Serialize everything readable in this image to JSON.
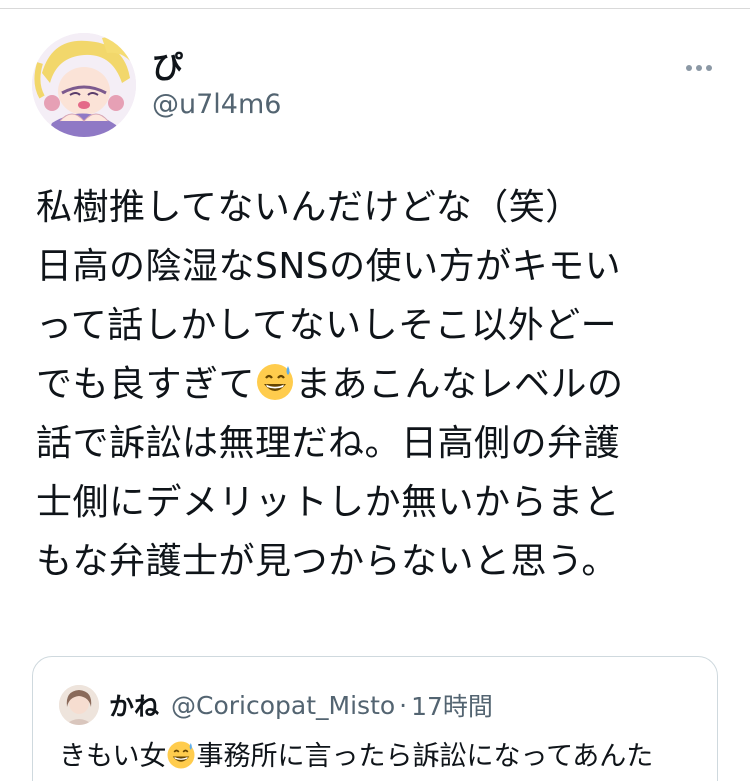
{
  "tweet": {
    "author": {
      "display_name": "ぴ",
      "handle": "@u7l4m6",
      "avatar_icon": "avatar-illustration"
    },
    "more_icon": "more-horizontal-icon",
    "text_lines": [
      "私樹推してないんだけどな（笑）",
      "日高の陰湿なSNSの使い方がキモい",
      "って話しかしてないしそこ以外どー",
      "でも良すぎて",
      "まあこんなレベルの",
      "話で訴訟は無理だね。日高側の弁護",
      "士側にデメリットしか無いからまと",
      "もな弁護士が見つからないと思う。"
    ],
    "emoji": "grinning-sweat-emoji"
  },
  "quote": {
    "display_name": "かね",
    "handle": "@Coricopat_Misto",
    "separator": "·",
    "time": "17時間",
    "text_before_emoji": "きもい女",
    "text_after_emoji": "事務所に言ったら訴訟になってあんた",
    "emoji": "grinning-sweat-emoji"
  },
  "colors": {
    "text_primary": "#0f1419",
    "text_secondary": "#536471",
    "border": "#cfd9de"
  }
}
